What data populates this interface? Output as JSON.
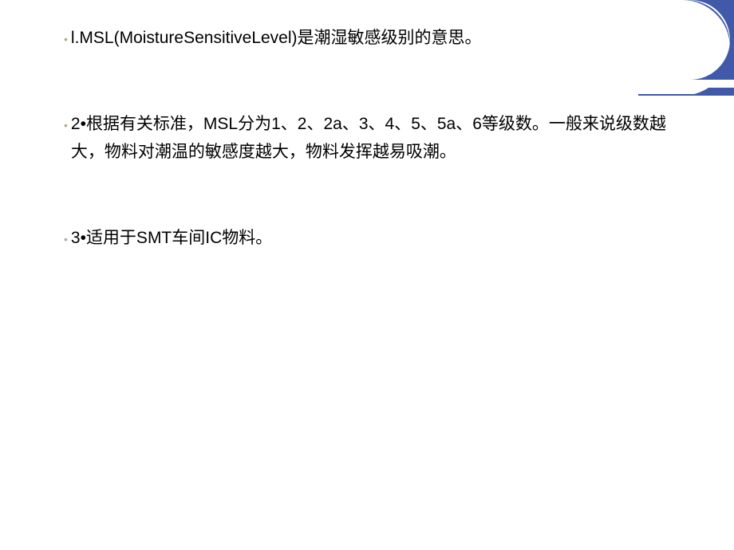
{
  "slide": {
    "bullets": [
      {
        "marker": "•",
        "text": "l.MSL(MoistureSensitiveLevel)是潮湿敏感级别的意思。"
      },
      {
        "marker": "•",
        "text": "2•根据有关标准，MSL分为1、2、2a、3、4、5、5a、6等级数。一般来说级数越大，物料对潮温的敏感度越大，物料发挥越易吸潮。"
      },
      {
        "marker": "•",
        "text": "3•适用于SMT车间IC物料。"
      }
    ]
  }
}
